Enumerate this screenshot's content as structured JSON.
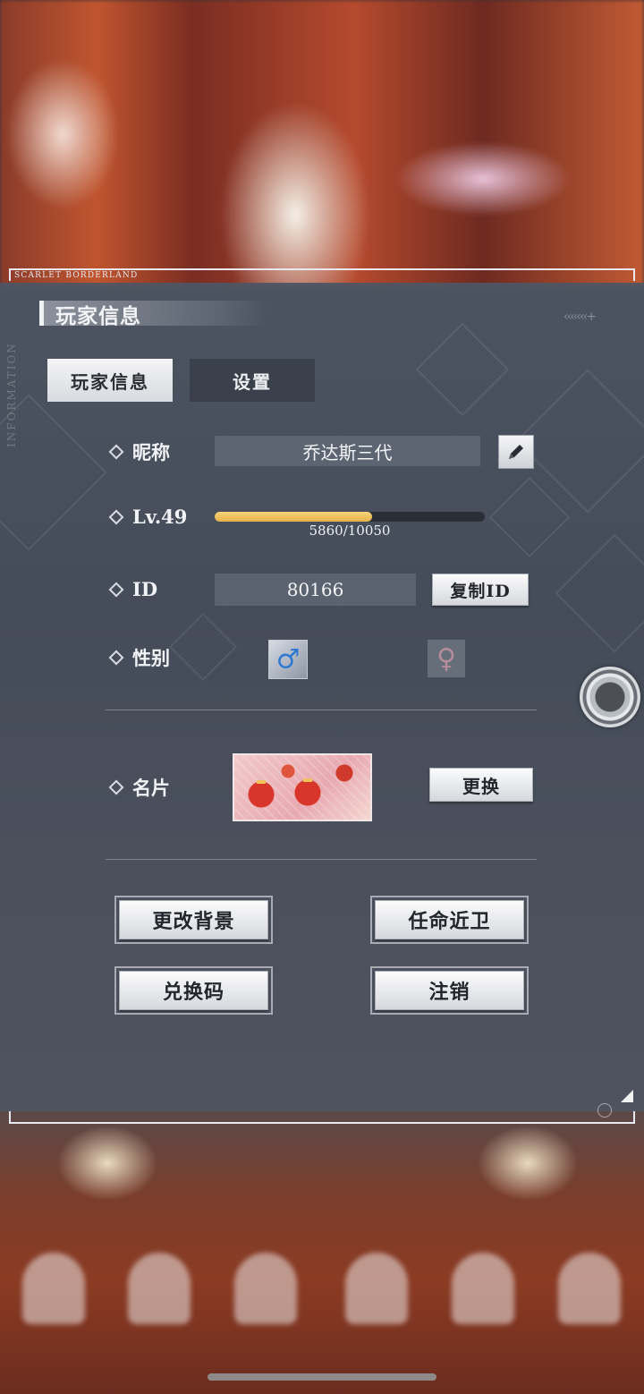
{
  "frame": {
    "brand": "SCARLET BORDERLAND",
    "side_text": "INFORMATION"
  },
  "header": {
    "title": "玩家信息"
  },
  "tabs": [
    {
      "label": "玩家信息",
      "active": true
    },
    {
      "label": "设置",
      "active": false
    }
  ],
  "profile": {
    "nickname_label": "昵称",
    "nickname_value": "乔达斯三代",
    "level_label": "Lv.49",
    "xp_current": 5860,
    "xp_max": 10050,
    "xp_text": "5860/10050",
    "id_label": "ID",
    "id_value": "80166",
    "copy_id_label": "复制ID",
    "gender_label": "性别",
    "gender_selected": "male",
    "namecard_label": "名片",
    "change_label": "更换"
  },
  "actions": {
    "change_background": "更改背景",
    "appoint_guard": "任命近卫",
    "redeem_code": "兑换码",
    "logout": "注销"
  },
  "icons": {
    "edit": "pencil-icon",
    "male": "male-icon",
    "female": "female-icon",
    "joystick": "joystick-icon"
  },
  "colors": {
    "panel": "#4e5664",
    "accent_gold": "#e6b349",
    "male_blue": "#2f7ad0",
    "female_pink": "#b58c9a"
  }
}
